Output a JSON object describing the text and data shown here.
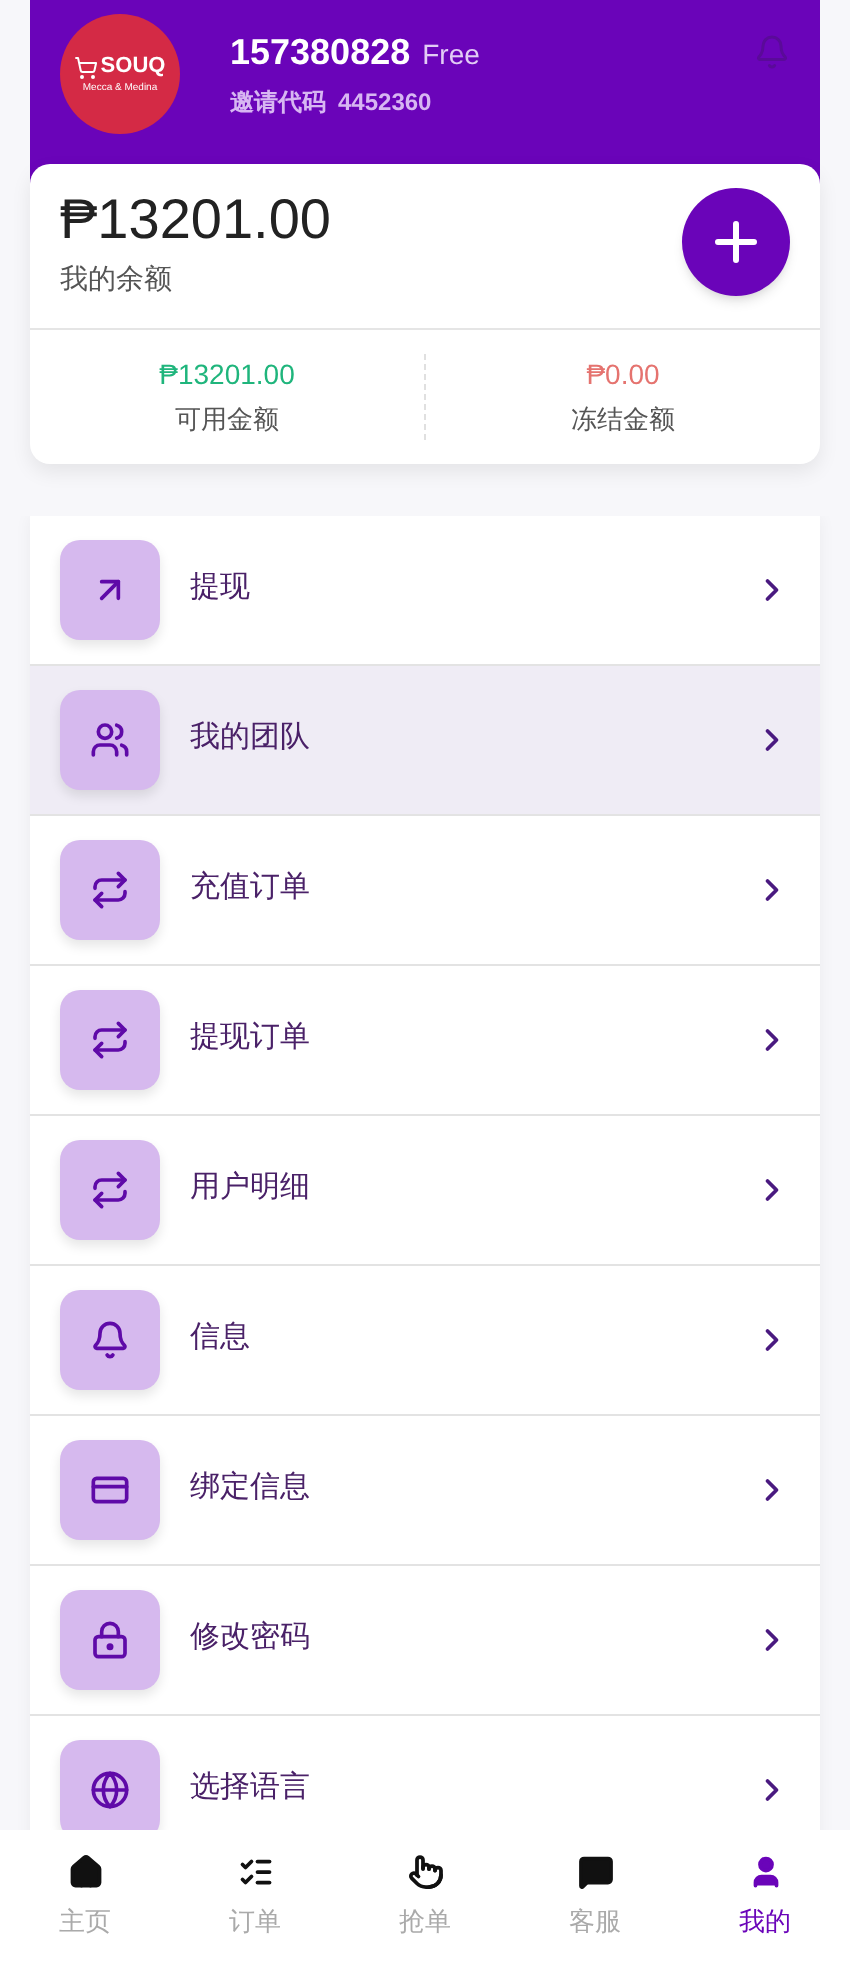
{
  "header": {
    "logo": {
      "name": "SOUQ",
      "tagline": "Mecca & Medina"
    },
    "username": "157380828",
    "tier": "Free",
    "invite_label": "邀请代码",
    "invite_code": "4452360"
  },
  "balance": {
    "amount": "₱13201.00",
    "label": "我的余额",
    "available": {
      "amount": "₱13201.00",
      "label": "可用金额"
    },
    "frozen": {
      "amount": "₱0.00",
      "label": "冻结金额"
    }
  },
  "menu": [
    {
      "kind": "withdraw",
      "label": "提现",
      "selected": false
    },
    {
      "kind": "team",
      "label": "我的团队",
      "selected": true
    },
    {
      "kind": "transfer",
      "label": "充值订单",
      "selected": false
    },
    {
      "kind": "transfer",
      "label": "提现订单",
      "selected": false
    },
    {
      "kind": "transfer",
      "label": "用户明细",
      "selected": false
    },
    {
      "kind": "notify",
      "label": "信息",
      "selected": false
    },
    {
      "kind": "card",
      "label": "绑定信息",
      "selected": false
    },
    {
      "kind": "lock",
      "label": "修改密码",
      "selected": false
    },
    {
      "kind": "language",
      "label": "选择语言",
      "selected": false
    }
  ],
  "bottom_nav": [
    {
      "kind": "home",
      "label": "主页",
      "selected": false
    },
    {
      "kind": "orders",
      "label": "订单",
      "selected": false
    },
    {
      "kind": "grab",
      "label": "抢单",
      "selected": false
    },
    {
      "kind": "service",
      "label": "客服",
      "selected": false
    },
    {
      "kind": "profile",
      "label": "我的",
      "selected": true
    }
  ]
}
